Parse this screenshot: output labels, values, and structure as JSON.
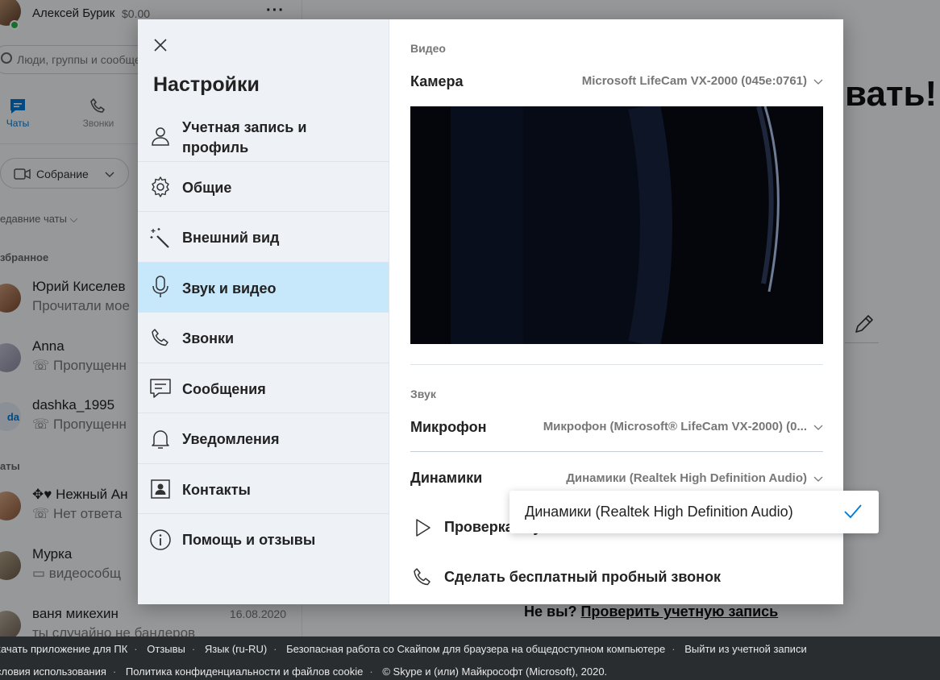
{
  "sidebar": {
    "profile_name": "Алексей Бурик",
    "balance": "$0.00",
    "search_placeholder": "Люди, группы и сообщения",
    "tabs": [
      {
        "label": "Чаты"
      },
      {
        "label": "Звонки"
      }
    ],
    "meeting_button": "Собрание",
    "recent_chats": "едавние чаты",
    "favorites_header": "збранное",
    "chats_header": "аты",
    "chats": [
      {
        "name": "Юрий Киселев",
        "message": "Прочитали мое"
      },
      {
        "name": "Anna",
        "message": "Пропущенн"
      },
      {
        "name": "dashka_1995",
        "message": "Пропущенн",
        "initials": "da"
      },
      {
        "name": "Нежный Ан",
        "message": "Нет ответа"
      },
      {
        "name": "Мурка",
        "message": "видеособщ"
      },
      {
        "name": "ваня микехин",
        "message": "ты случайно не бандеров",
        "date": "16.08.2020"
      }
    ]
  },
  "main": {
    "title_fragment": "вать!",
    "not_you": "Не вы?",
    "check_account": "Проверить учетную запись"
  },
  "settings": {
    "title": "Настройки",
    "nav": [
      {
        "label": "Учетная запись и профиль",
        "icon": "person-icon"
      },
      {
        "label": "Общие",
        "icon": "gear-icon"
      },
      {
        "label": "Внешний вид",
        "icon": "magic-wand-icon"
      },
      {
        "label": "Звук и видео",
        "icon": "microphone-icon",
        "active": true
      },
      {
        "label": "Звонки",
        "icon": "phone-icon"
      },
      {
        "label": "Сообщения",
        "icon": "message-icon"
      },
      {
        "label": "Уведомления",
        "icon": "bell-icon"
      },
      {
        "label": "Контакты",
        "icon": "contacts-icon"
      },
      {
        "label": "Помощь и отзывы",
        "icon": "info-icon"
      }
    ],
    "video_header": "Видео",
    "camera_label": "Камера",
    "camera_value": "Microsoft LifeCam VX-2000 (045e:0761)",
    "audio_header": "Звук",
    "mic_label": "Микрофон",
    "mic_value": "Микрофон (Microsoft® LifeCam VX-2000) (0...",
    "speakers_label": "Динамики",
    "speakers_value": "Динамики (Realtek High Definition Audio)",
    "test_audio": "Проверка звука",
    "test_call": "Сделать бесплатный пробный звонок",
    "speakers_dropdown": {
      "option": "Динамики (Realtek High Definition Audio)",
      "selected": true
    }
  },
  "footer": {
    "row1": [
      "качать приложение для ПК",
      "Отзывы",
      "Язык (ru-RU)",
      "Безопасная работа со Скайпом для браузера на общедоступном компьютере",
      "Выйти из учетной записи"
    ],
    "row2": [
      "словия использования",
      "Политика конфиденциальности и файлов cookie",
      "© Skype и (или) Майкрософт (Microsoft), 2020."
    ]
  },
  "colors": {
    "accent": "#0078d4",
    "active_nav": "#c7e7fa",
    "footer_bg": "#2a2d30",
    "online": "#26b24b"
  }
}
